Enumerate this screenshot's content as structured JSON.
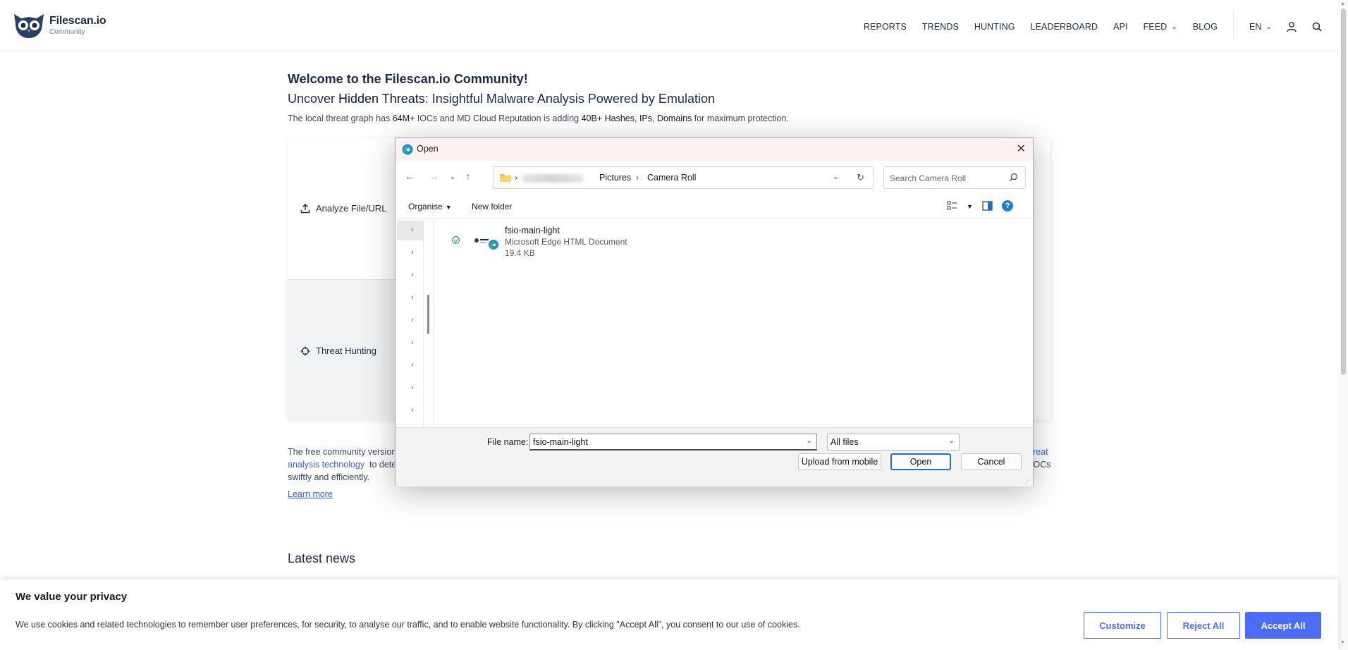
{
  "site": {
    "brand": "Filescan.io",
    "brand_sub": "Community",
    "nav": [
      "REPORTS",
      "TRENDS",
      "HUNTING",
      "LEADERBOARD",
      "API",
      "FEED",
      "BLOG"
    ],
    "lang": "EN"
  },
  "main": {
    "welcome": "Welcome to the Filescan.io Community!",
    "tagline_pre": "Uncover ",
    "tagline_bold": "Hidden Threats",
    "tagline_post": ": Insightful Malware Analysis Powered by Emulation",
    "stats": {
      "p1": "The local threat graph has ",
      "b1": "64M+",
      "p2": " IOCs and MD Cloud Reputation is adding ",
      "b2": "40B+ Hashes",
      "p3": ", ",
      "b3": "IPs",
      "p4": ", ",
      "b4": "Domains",
      "p5": " for maximum protection."
    },
    "tabs": {
      "analyze": "Analyze File/URL",
      "hunting": "Threat Hunting"
    },
    "about": {
      "line1_start": "The free community version",
      "line1_end_link": "reat",
      "line2_link": "analysis technology",
      "line2_rest": "to dete",
      "line2_end": "IOCs",
      "line3": "swiftly and efficiently."
    },
    "learn_more": "Learn more",
    "latest_news": "Latest news"
  },
  "cookie": {
    "title": "We value your privacy",
    "text": "We use cookies and related technologies to remember user preferences, for security, to analyse our traffic, and to enable website functionality. By clicking \"Accept All\", you consent to our use of cookies.",
    "customize": "Customize",
    "reject": "Reject All",
    "accept": "Accept All"
  },
  "dialog": {
    "title": "Open",
    "path": [
      "Pictures",
      "Camera Roll"
    ],
    "search_placeholder": "Search Camera Roll",
    "organise": "Organise",
    "new_folder": "New folder",
    "file": {
      "name": "fsio-main-light",
      "type": "Microsoft Edge HTML Document",
      "size": "19.4 KB"
    },
    "file_name_label": "File name:",
    "file_name_value": "fsio-main-light",
    "file_type": "All files",
    "upload_mobile": "Upload from mobile",
    "open": "Open",
    "cancel": "Cancel"
  },
  "colors": {
    "accent": "#4a6cf7",
    "navy": "#1b2a4a",
    "link": "#3b5bdb",
    "dialog_focus": "#1e6fd6"
  }
}
